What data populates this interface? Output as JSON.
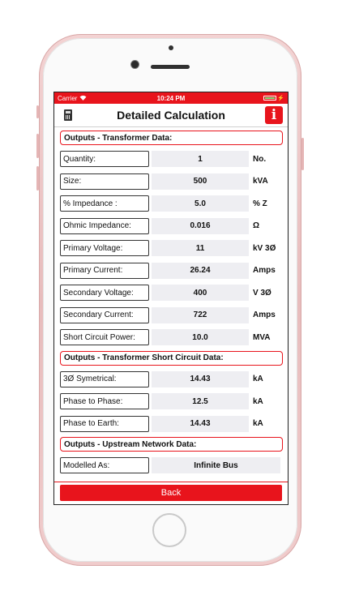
{
  "statusbar": {
    "carrier": "Carrier",
    "time": "10:24 PM"
  },
  "navbar": {
    "title": "Detailed Calculation",
    "info_label": "i"
  },
  "sections": {
    "transformer": {
      "title": "Outputs - Transformer Data:",
      "rows": [
        {
          "label": "Quantity:",
          "value": "1",
          "unit": "No."
        },
        {
          "label": "Size:",
          "value": "500",
          "unit": "kVA"
        },
        {
          "label": "% Impedance :",
          "value": "5.0",
          "unit": "% Z"
        },
        {
          "label": "Ohmic Impedance:",
          "value": "0.016",
          "unit": "Ω"
        },
        {
          "label": "Primary Voltage:",
          "value": "11",
          "unit": "kV 3Ø"
        },
        {
          "label": "Primary Current:",
          "value": "26.24",
          "unit": "Amps"
        },
        {
          "label": "Secondary Voltage:",
          "value": "400",
          "unit": "V 3Ø"
        },
        {
          "label": "Secondary Current:",
          "value": "722",
          "unit": "Amps"
        },
        {
          "label": "Short Circuit Power:",
          "value": "10.0",
          "unit": "MVA"
        }
      ]
    },
    "short_circuit": {
      "title": "Outputs - Transformer Short Circuit Data:",
      "rows": [
        {
          "label": "3Ø Symetrical:",
          "value": "14.43",
          "unit": "kA"
        },
        {
          "label": "Phase to Phase:",
          "value": "12.5",
          "unit": "kA"
        },
        {
          "label": "Phase to Earth:",
          "value": "14.43",
          "unit": "kA"
        }
      ]
    },
    "upstream": {
      "title": "Outputs - Upstream Network Data:",
      "rows": [
        {
          "label": "Modelled As:",
          "value": "Infinite Bus"
        }
      ]
    }
  },
  "back_button": {
    "label": "Back"
  },
  "colors": {
    "accent": "#e8141c",
    "value_bg": "#eeeef2"
  }
}
